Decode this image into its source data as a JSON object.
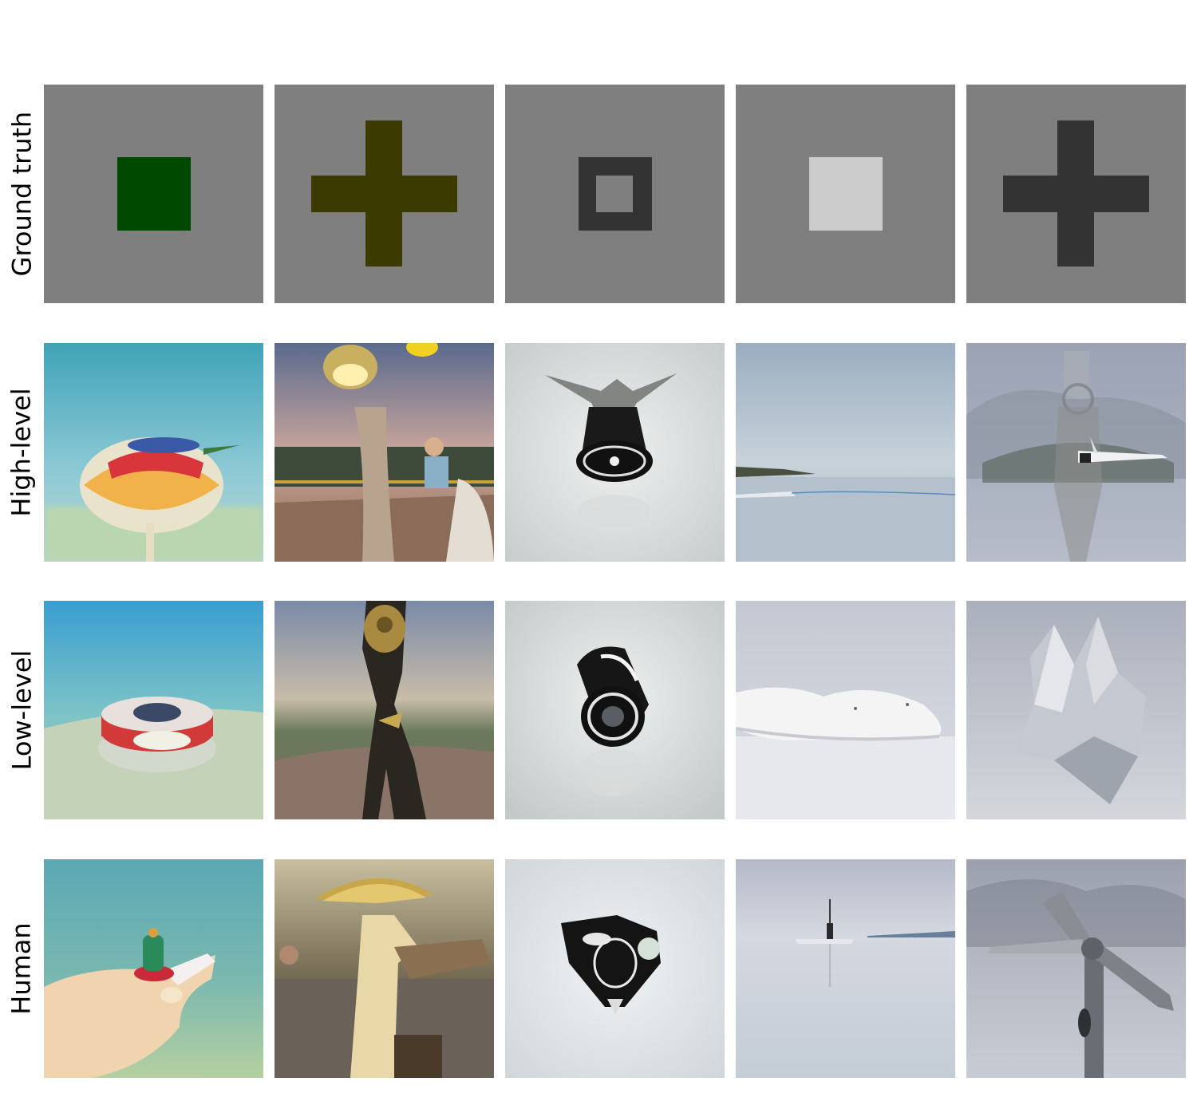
{
  "rows": [
    {
      "label": "Ground truth",
      "cells": [
        {
          "subject": "square",
          "color": "#004900"
        },
        {
          "subject": "cross",
          "color": "#3b3a00"
        },
        {
          "subject": "hollow-square",
          "color": "#333333"
        },
        {
          "subject": "square",
          "color": "#cccccc"
        },
        {
          "subject": "cross",
          "color": "#333333"
        }
      ]
    },
    {
      "label": "High-level",
      "cells": [
        {
          "subject": "balloon-toy-photo"
        },
        {
          "subject": "lamp-statue-street-photo"
        },
        {
          "subject": "black-object-photo"
        },
        {
          "subject": "lake-horizon-photo"
        },
        {
          "subject": "airplane-figure-photo"
        }
      ]
    },
    {
      "label": "Low-level",
      "cells": [
        {
          "subject": "disc-toy-photo"
        },
        {
          "subject": "ornate-statue-photo"
        },
        {
          "subject": "black-cylinder-photo"
        },
        {
          "subject": "white-shoe-photo"
        },
        {
          "subject": "paper-sculpture-photo"
        }
      ]
    },
    {
      "label": "Human",
      "cells": [
        {
          "subject": "hand-holding-figure-photo"
        },
        {
          "subject": "gold-statue-street-photo"
        },
        {
          "subject": "black-object-photo"
        },
        {
          "subject": "boat-on-lake-photo"
        },
        {
          "subject": "pole-propeller-photo"
        }
      ]
    }
  ],
  "colors": {
    "gt_background": "#7f7f7f"
  }
}
